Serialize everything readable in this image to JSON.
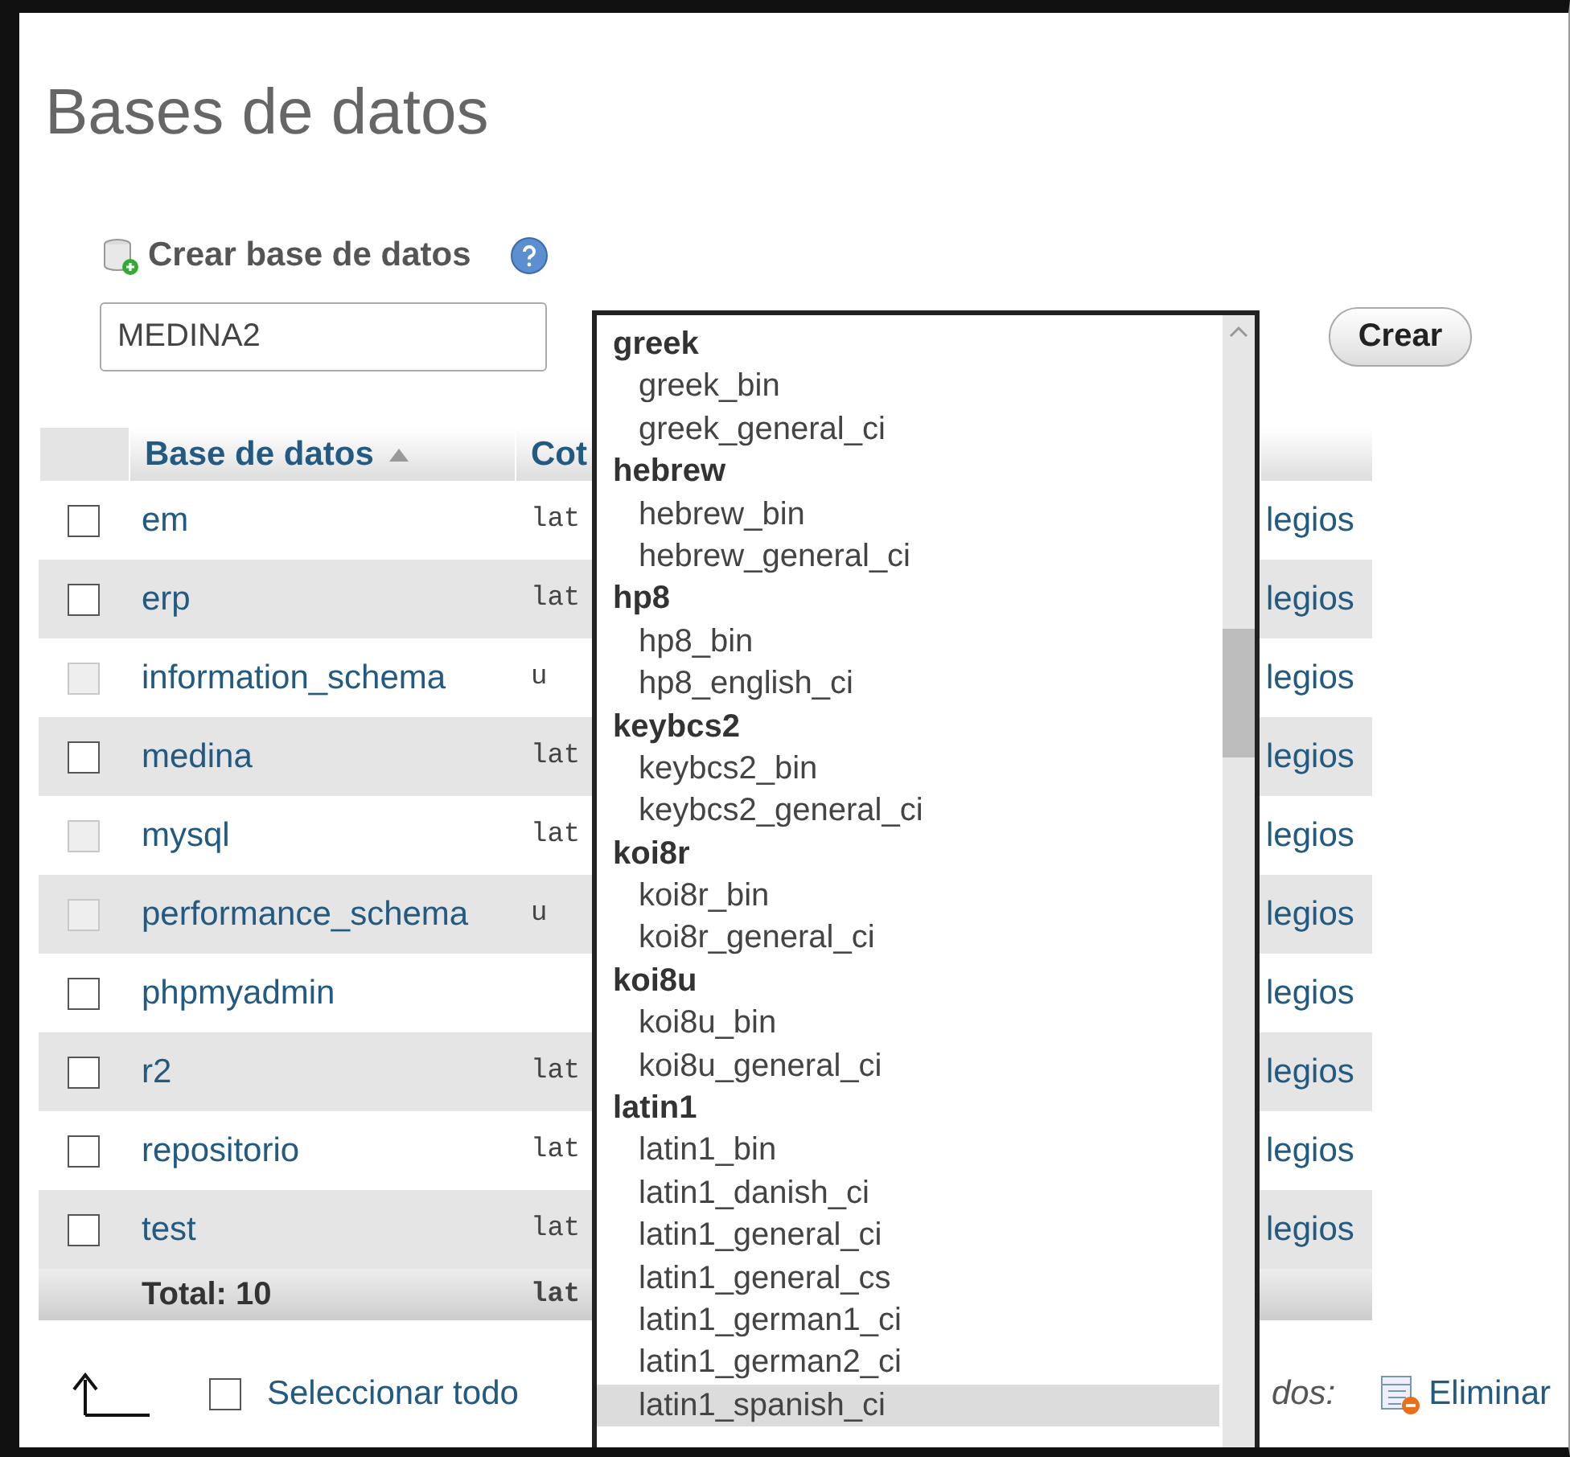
{
  "page_title": "Bases de datos",
  "create": {
    "label": "Crear base de datos",
    "name_value": "MEDINA2",
    "button": "Crear"
  },
  "table": {
    "columns": [
      "Base de datos",
      "Cot"
    ],
    "rows": [
      {
        "name": "em",
        "collation": "lat",
        "privileges": "legios",
        "checked": false,
        "disabled": false
      },
      {
        "name": "erp",
        "collation": "lat",
        "privileges": "legios",
        "checked": false,
        "disabled": false
      },
      {
        "name": "information_schema",
        "collation": "u",
        "privileges": "legios",
        "checked": false,
        "disabled": true
      },
      {
        "name": "medina",
        "collation": "lat",
        "privileges": "legios",
        "checked": false,
        "disabled": false
      },
      {
        "name": "mysql",
        "collation": "lat",
        "privileges": "legios",
        "checked": false,
        "disabled": true
      },
      {
        "name": "performance_schema",
        "collation": "u",
        "privileges": "legios",
        "checked": false,
        "disabled": true
      },
      {
        "name": "phpmyadmin",
        "collation": "",
        "privileges": "legios",
        "checked": false,
        "disabled": false
      },
      {
        "name": "r2",
        "collation": "lat",
        "privileges": "legios",
        "checked": false,
        "disabled": false
      },
      {
        "name": "repositorio",
        "collation": "lat",
        "privileges": "legios",
        "checked": false,
        "disabled": false
      },
      {
        "name": "test",
        "collation": "lat",
        "privileges": "legios",
        "checked": false,
        "disabled": false
      }
    ],
    "total": {
      "label": "Total: 10",
      "collation": "lat"
    }
  },
  "footer": {
    "select_all": "Seleccionar todo",
    "select_all_checked": false,
    "with_selected": "dos:",
    "delete": "Eliminar"
  },
  "collation_dropdown": {
    "items": [
      {
        "kind": "group",
        "label": "greek"
      },
      {
        "kind": "option",
        "label": "greek_bin",
        "selected": false
      },
      {
        "kind": "option",
        "label": "greek_general_ci",
        "selected": false
      },
      {
        "kind": "group",
        "label": "hebrew"
      },
      {
        "kind": "option",
        "label": "hebrew_bin",
        "selected": false
      },
      {
        "kind": "option",
        "label": "hebrew_general_ci",
        "selected": false
      },
      {
        "kind": "group",
        "label": "hp8"
      },
      {
        "kind": "option",
        "label": "hp8_bin",
        "selected": false
      },
      {
        "kind": "option",
        "label": "hp8_english_ci",
        "selected": false
      },
      {
        "kind": "group",
        "label": "keybcs2"
      },
      {
        "kind": "option",
        "label": "keybcs2_bin",
        "selected": false
      },
      {
        "kind": "option",
        "label": "keybcs2_general_ci",
        "selected": false
      },
      {
        "kind": "group",
        "label": "koi8r"
      },
      {
        "kind": "option",
        "label": "koi8r_bin",
        "selected": false
      },
      {
        "kind": "option",
        "label": "koi8r_general_ci",
        "selected": false
      },
      {
        "kind": "group",
        "label": "koi8u"
      },
      {
        "kind": "option",
        "label": "koi8u_bin",
        "selected": false
      },
      {
        "kind": "option",
        "label": "koi8u_general_ci",
        "selected": false
      },
      {
        "kind": "group",
        "label": "latin1"
      },
      {
        "kind": "option",
        "label": "latin1_bin",
        "selected": false
      },
      {
        "kind": "option",
        "label": "latin1_danish_ci",
        "selected": false
      },
      {
        "kind": "option",
        "label": "latin1_general_ci",
        "selected": false
      },
      {
        "kind": "option",
        "label": "latin1_general_cs",
        "selected": false
      },
      {
        "kind": "option",
        "label": "latin1_german1_ci",
        "selected": false
      },
      {
        "kind": "option",
        "label": "latin1_german2_ci",
        "selected": false
      },
      {
        "kind": "option",
        "label": "latin1_spanish_ci",
        "selected": true
      }
    ]
  }
}
